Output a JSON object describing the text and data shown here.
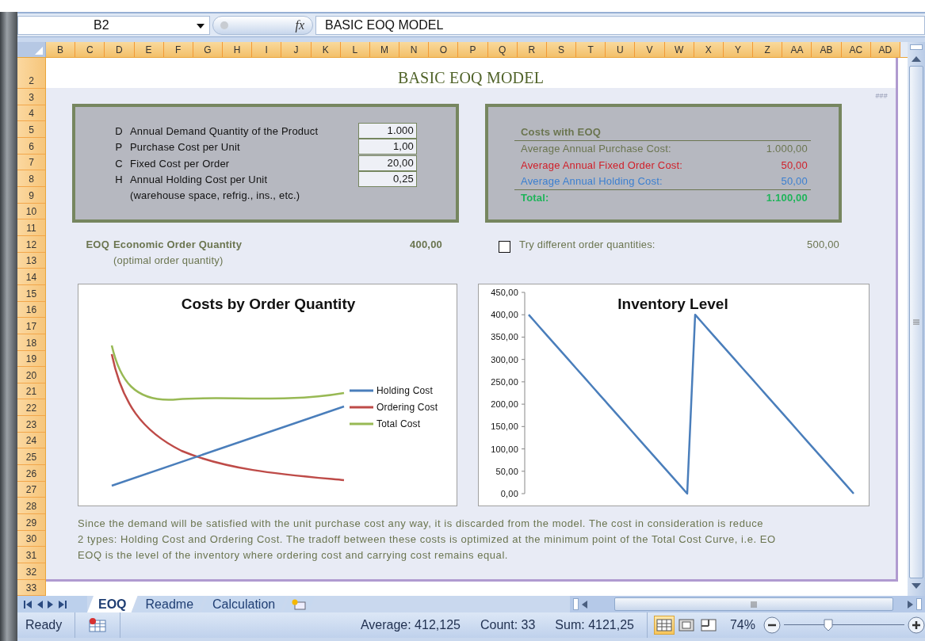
{
  "formula_bar": {
    "name_box": "B2",
    "fx": "fx",
    "formula": "BASIC EOQ MODEL"
  },
  "columns": [
    "B",
    "C",
    "D",
    "E",
    "F",
    "G",
    "H",
    "I",
    "J",
    "K",
    "L",
    "M",
    "N",
    "O",
    "P",
    "Q",
    "R",
    "S",
    "T",
    "U",
    "V",
    "W",
    "X",
    "Y",
    "Z",
    "AA",
    "AB",
    "AC",
    "AD"
  ],
  "rows": [
    "2",
    "3",
    "4",
    "5",
    "6",
    "7",
    "8",
    "9",
    "10",
    "11",
    "12",
    "13",
    "14",
    "15",
    "16",
    "17",
    "18",
    "19",
    "20",
    "21",
    "22",
    "23",
    "24",
    "25",
    "26",
    "27",
    "28",
    "29",
    "30",
    "31",
    "32",
    "33"
  ],
  "title": "BASIC EOQ MODEL",
  "overflow_mark": "###",
  "inputs": [
    {
      "symbol": "D",
      "label": "Annual Demand Quantity of the Product",
      "value": "1.000"
    },
    {
      "symbol": "P",
      "label": "Purchase Cost per Unit",
      "value": "1,00"
    },
    {
      "symbol": "C",
      "label": "Fixed Cost per Order",
      "value": "20,00"
    },
    {
      "symbol": "H",
      "label": "Annual Holding Cost per Unit",
      "value": "0,25"
    }
  ],
  "inputs_note": "(warehouse space, refrig., ins., etc.)",
  "costs": {
    "heading": "Costs with EOQ",
    "rows": [
      {
        "kind": "line",
        "label": "Average Annual Purchase Cost:",
        "value": "1.000,00",
        "color": "#6b7550"
      },
      {
        "kind": "line",
        "label": "Average Annual Fixed Order Cost:",
        "value": "50,00",
        "color": "#d0202a"
      },
      {
        "kind": "line",
        "label": "Average Annual Holding Cost:",
        "value": "50,00",
        "color": "#3b7fd0"
      },
      {
        "kind": "total",
        "label": "Total:",
        "value": "1.100,00",
        "color": "#1fb45a"
      }
    ]
  },
  "eoq": {
    "symbol": "EOQ",
    "label": "Economic Order Quantity",
    "note": "(optimal order quantity)",
    "value": "400,00"
  },
  "try": {
    "checked": false,
    "label": "Try different order quantities:",
    "value": "500,00"
  },
  "cost_chart": {
    "title": "Costs by Order Quantity",
    "legend": [
      {
        "name": "Holding Cost",
        "color": "#4a7ebb"
      },
      {
        "name": "Ordering Cost",
        "color": "#be4b48"
      },
      {
        "name": "Total Cost",
        "color": "#98b954"
      }
    ]
  },
  "inventory_chart": {
    "chart_data": {
      "type": "line",
      "title": "Inventory Level",
      "ylim": [
        0,
        450
      ],
      "series": [
        {
          "color": "#4a7ebb",
          "values": [
            400,
            380,
            360,
            340,
            320,
            300,
            280,
            260,
            240,
            220,
            200,
            180,
            160,
            140,
            120,
            100,
            80,
            60,
            40,
            20,
            0,
            400,
            380,
            360,
            340,
            320,
            300,
            280,
            260,
            240,
            220,
            200,
            180,
            160,
            140,
            120,
            100,
            80,
            60,
            40,
            20,
            0
          ]
        }
      ],
      "yticks": [
        {
          "value": 0,
          "label": "0,00"
        },
        {
          "value": 50,
          "label": "50,00"
        },
        {
          "value": 100,
          "label": "100,00"
        },
        {
          "value": 150,
          "label": "150,00"
        },
        {
          "value": 200,
          "label": "200,00"
        },
        {
          "value": 250,
          "label": "250,00"
        },
        {
          "value": 300,
          "label": "300,00"
        },
        {
          "value": 350,
          "label": "350,00"
        },
        {
          "value": 400,
          "label": "400,00"
        },
        {
          "value": 450,
          "label": "450,00"
        }
      ]
    }
  },
  "notes": [
    "Since the demand will be satisfied with the unit purchase cost any way, it is discarded from the model. The cost in consideration is reduce",
    "2 types: Holding Cost and Ordering Cost. The tradoff between these costs is optimized at the minimum point of the Total Cost Curve, i.e. EO",
    "EOQ is the level of the inventory where ordering cost and carrying cost remains equal."
  ],
  "sheet_tabs": [
    {
      "label": "EOQ",
      "selected": true
    },
    {
      "label": "Readme",
      "selected": false
    },
    {
      "label": "Calculation",
      "selected": false
    }
  ],
  "status_bar": {
    "mode": "Ready",
    "average": "Average: 412,125",
    "count": "Count: 33",
    "sum": "Sum: 4121,25",
    "views": [
      {
        "kind": "normal",
        "selected": true
      },
      {
        "kind": "page_layout",
        "selected": false
      },
      {
        "kind": "page_break",
        "selected": false
      }
    ],
    "zoom": "74%",
    "zoom_slider": {
      "level": 0.37
    }
  }
}
